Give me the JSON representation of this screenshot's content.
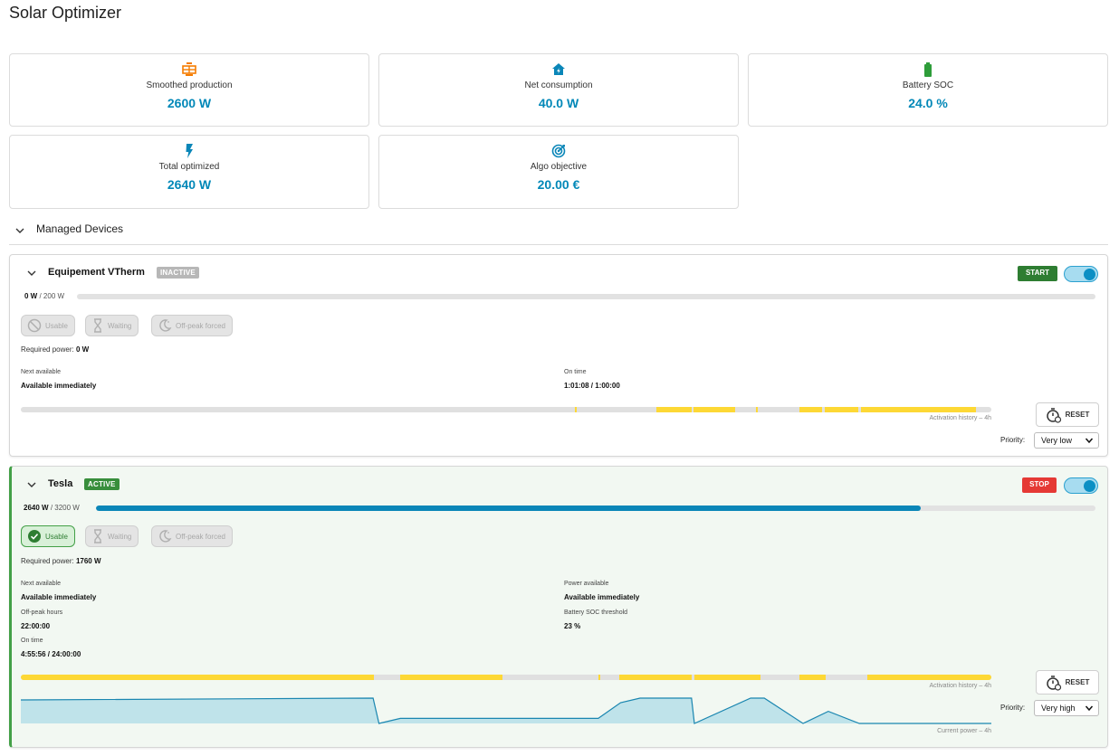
{
  "page": {
    "title": "Solar Optimizer"
  },
  "stats": [
    {
      "icon": "solar-panel-icon",
      "label": "Smoothed production",
      "value": "2600 W"
    },
    {
      "icon": "home-lightning-icon",
      "label": "Net consumption",
      "value": "40.0 W"
    },
    {
      "icon": "battery-icon",
      "label": "Battery SOC",
      "value": "24.0 %"
    },
    {
      "icon": "flash-icon",
      "label": "Total optimized",
      "value": "2640 W"
    },
    {
      "icon": "target-icon",
      "label": "Algo objective",
      "value": "20.00 €"
    }
  ],
  "colors": {
    "accent": "#0288b8",
    "active": "#388e3c",
    "stop": "#e53935",
    "history": "#fdd835",
    "toggle": "#0b8fc4"
  },
  "section": {
    "title": "Managed Devices"
  },
  "devices": [
    {
      "name": "Equipement VTherm",
      "status": "INACTIVE",
      "action_label": "START",
      "enabled": true,
      "power_current": "0 W",
      "power_max": "/ 200 W",
      "power_fraction": 0.0,
      "chips": [
        {
          "icon": "block-icon",
          "label": "Usable",
          "active": false
        },
        {
          "icon": "hourglass-icon",
          "label": "Waiting",
          "active": false
        },
        {
          "icon": "moon-icon",
          "label": "Off-peak forced",
          "active": false
        }
      ],
      "required_power_label": "Required power:",
      "required_power_value": "0 W",
      "info": [
        {
          "label": "Next available",
          "value": "Available immediately"
        },
        {
          "label": "On time",
          "value": "1:01:08 / 1:00:00"
        }
      ],
      "history_caption": "Activation history – 4h",
      "reset_label": "RESET",
      "priority_label": "Priority:",
      "priority_value": "Very low"
    },
    {
      "name": "Tesla",
      "status": "ACTIVE",
      "action_label": "STOP",
      "enabled": true,
      "power_current": "2640 W",
      "power_max": "/ 3200 W",
      "power_fraction": 0.825,
      "chips": [
        {
          "icon": "check-circle-icon",
          "label": "Usable",
          "active": true
        },
        {
          "icon": "hourglass-icon",
          "label": "Waiting",
          "active": false
        },
        {
          "icon": "moon-icon",
          "label": "Off-peak forced",
          "active": false
        }
      ],
      "required_power_label": "Required power:",
      "required_power_value": "1760 W",
      "info": [
        {
          "label": "Next available",
          "value": "Available immediately"
        },
        {
          "label": "Power available",
          "value": "Available immediately"
        },
        {
          "label": "Off-peak hours",
          "value": "22:00:00"
        },
        {
          "label": "Battery SOC threshold",
          "value": "23 %"
        },
        {
          "label": "On time",
          "value": "4:55:56 / 24:00:00"
        }
      ],
      "history_caption": "Activation history – 4h",
      "power_caption": "Current power – 4h",
      "reset_label": "RESET",
      "priority_label": "Priority:",
      "priority_value": "Very high"
    }
  ],
  "chart_data": [
    {
      "type": "timeline",
      "name": "vtherm-activation-history",
      "active_segments": [
        [
          0.571,
          0.573
        ],
        [
          0.655,
          0.691
        ],
        [
          0.693,
          0.736
        ],
        [
          0.757,
          0.759
        ],
        [
          0.802,
          0.826
        ],
        [
          0.828,
          0.863
        ],
        [
          0.866,
          0.984
        ]
      ]
    },
    {
      "type": "timeline",
      "name": "tesla-activation-history",
      "active_segments": [
        [
          0.0,
          0.364
        ],
        [
          0.391,
          0.496
        ],
        [
          0.595,
          0.597
        ],
        [
          0.617,
          0.691
        ],
        [
          0.694,
          0.762
        ],
        [
          0.802,
          0.829
        ],
        [
          0.872,
          1.0
        ]
      ]
    },
    {
      "type": "area",
      "name": "tesla-current-power",
      "x": [
        0.0,
        0.363,
        0.369,
        0.391,
        0.595,
        0.618,
        0.638,
        0.691,
        0.694,
        0.752,
        0.766,
        0.806,
        0.832,
        0.864,
        1.0
      ],
      "y": [
        0.93,
        1.0,
        0.0,
        0.2,
        0.2,
        0.82,
        1.0,
        1.0,
        0.0,
        1.0,
        1.0,
        0.0,
        0.48,
        0.0,
        0.0
      ]
    }
  ]
}
